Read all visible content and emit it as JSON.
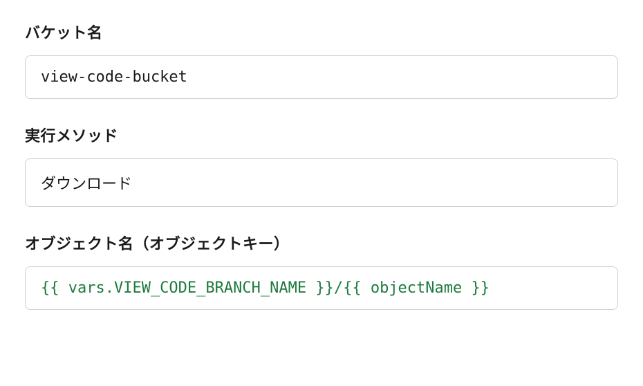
{
  "form": {
    "bucket": {
      "label": "バケット名",
      "value": "view-code-bucket"
    },
    "method": {
      "label": "実行メソッド",
      "value": "ダウンロード"
    },
    "objectKey": {
      "label": "オブジェクト名（オブジェクトキー）",
      "value": "{{ vars.VIEW_CODE_BRANCH_NAME }}/{{ objectName }}"
    }
  }
}
